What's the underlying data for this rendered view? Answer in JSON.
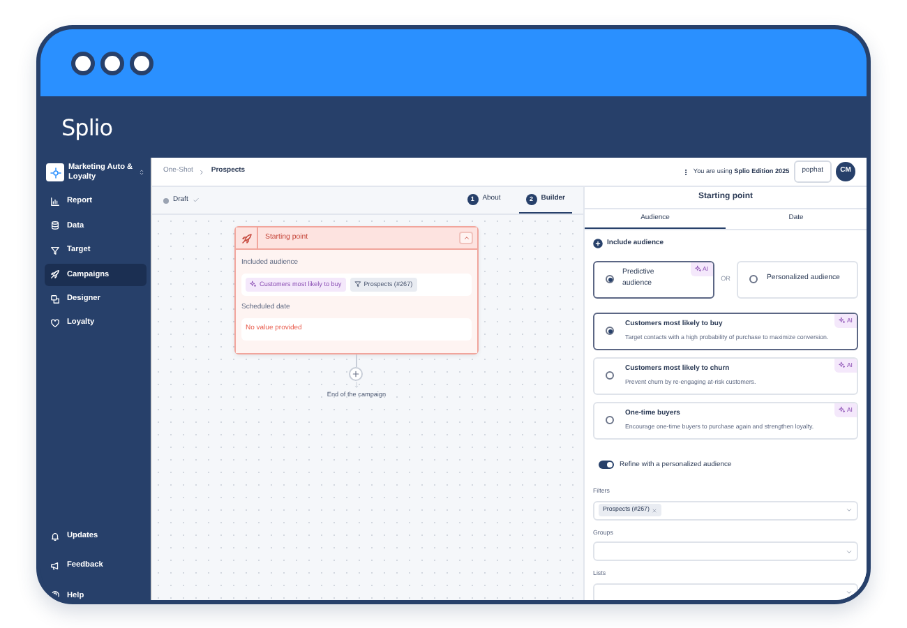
{
  "window": {
    "logo": "Splio"
  },
  "sidebar": {
    "workspace": "Marketing Auto & Loyalty",
    "items": [
      {
        "label": "Report",
        "kind": "chart",
        "selected": false
      },
      {
        "label": "Data",
        "kind": "database",
        "selected": false
      },
      {
        "label": "Target",
        "kind": "funnel",
        "selected": false
      },
      {
        "label": "Campaigns",
        "kind": "rocket",
        "selected": true
      },
      {
        "label": "Designer",
        "kind": "palette",
        "selected": false
      },
      {
        "label": "Loyalty",
        "kind": "heart",
        "selected": false
      }
    ],
    "footer_items": [
      {
        "label": "Updates",
        "kind": "bell"
      },
      {
        "label": "Feedback",
        "kind": "megaphone"
      },
      {
        "label": "Help",
        "kind": "help"
      }
    ]
  },
  "topbar": {
    "breadcrumb": [
      "One-Shot",
      "Prospects"
    ],
    "edition": "You are using **Splio Edition 2025**",
    "user_button": "pophat",
    "avatar": "CM"
  },
  "builder": {
    "status": "Draft",
    "steps": [
      {
        "number": "1",
        "label": "About",
        "selected": false
      },
      {
        "number": "2",
        "label": "Builder",
        "selected": true
      }
    ],
    "node": {
      "title": "Starting point",
      "sections": [
        {
          "label": "Included audience",
          "chips": [
            {
              "kind": "ai",
              "text": "Customers most likely to buy"
            },
            {
              "kind": "filter",
              "text": "Prospects (#267)"
            }
          ]
        },
        {
          "label": "Scheduled date",
          "empty_text": "No value provided"
        }
      ]
    },
    "end_label": "End of the campaign"
  },
  "panel": {
    "title": "Starting point",
    "tabs": [
      {
        "label": "Audience",
        "selected": true
      },
      {
        "label": "Date",
        "selected": false
      }
    ],
    "section_title": "Include audience",
    "audience_types": [
      {
        "label": "Predictive audience",
        "selected": true,
        "badge": "AI"
      },
      {
        "label": "Personalized audience",
        "selected": false
      }
    ],
    "or_label": "OR",
    "options": [
      {
        "title": "Customers most likely to buy",
        "description": "Target contacts with a high probability of purchase to maximize conversion.",
        "selected": true,
        "badge": "AI"
      },
      {
        "title": "Customers most likely to churn",
        "description": "Prevent churn by re-engaging at-risk customers.",
        "selected": false,
        "badge": "AI"
      },
      {
        "title": "One-time buyers",
        "description": "Encourage one-time buyers to purchase again and strengthen loyalty.",
        "selected": false,
        "badge": "AI"
      }
    ],
    "refine": {
      "label": "Refine with a personalized audience",
      "on": true
    },
    "fields": [
      {
        "label": "Filters",
        "tags": [
          "Prospects (#267)"
        ]
      },
      {
        "label": "Groups"
      },
      {
        "label": "Lists"
      }
    ]
  }
}
